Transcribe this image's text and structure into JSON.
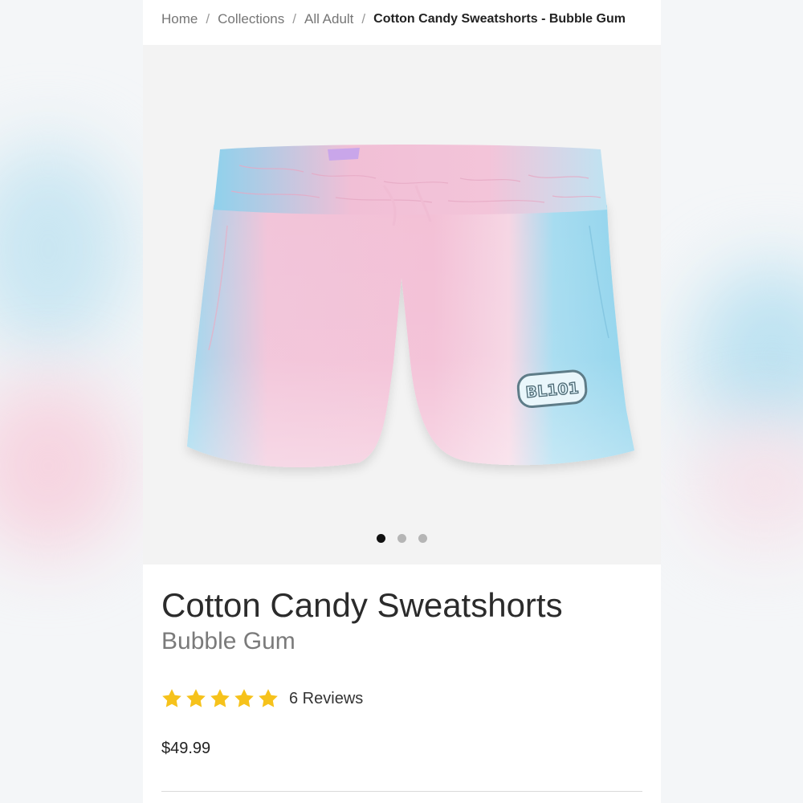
{
  "breadcrumb": {
    "items": [
      "Home",
      "Collections",
      "All Adult"
    ],
    "separator": "/",
    "current": "Cotton Candy Sweatshorts - Bubble Gum"
  },
  "gallery": {
    "image_alt": "Cotton Candy Sweatshorts product image",
    "logo_text": "BL101",
    "slide_count": 3,
    "active_slide": 1
  },
  "product": {
    "title": "Cotton Candy Sweatshorts",
    "variant": "Bubble Gum",
    "rating": 5,
    "reviews_label": "6 Reviews",
    "price": "$49.99"
  },
  "colors": {
    "star": "#f6c21b",
    "pink": "#f6c3d8",
    "blue": "#8fd6ee"
  }
}
